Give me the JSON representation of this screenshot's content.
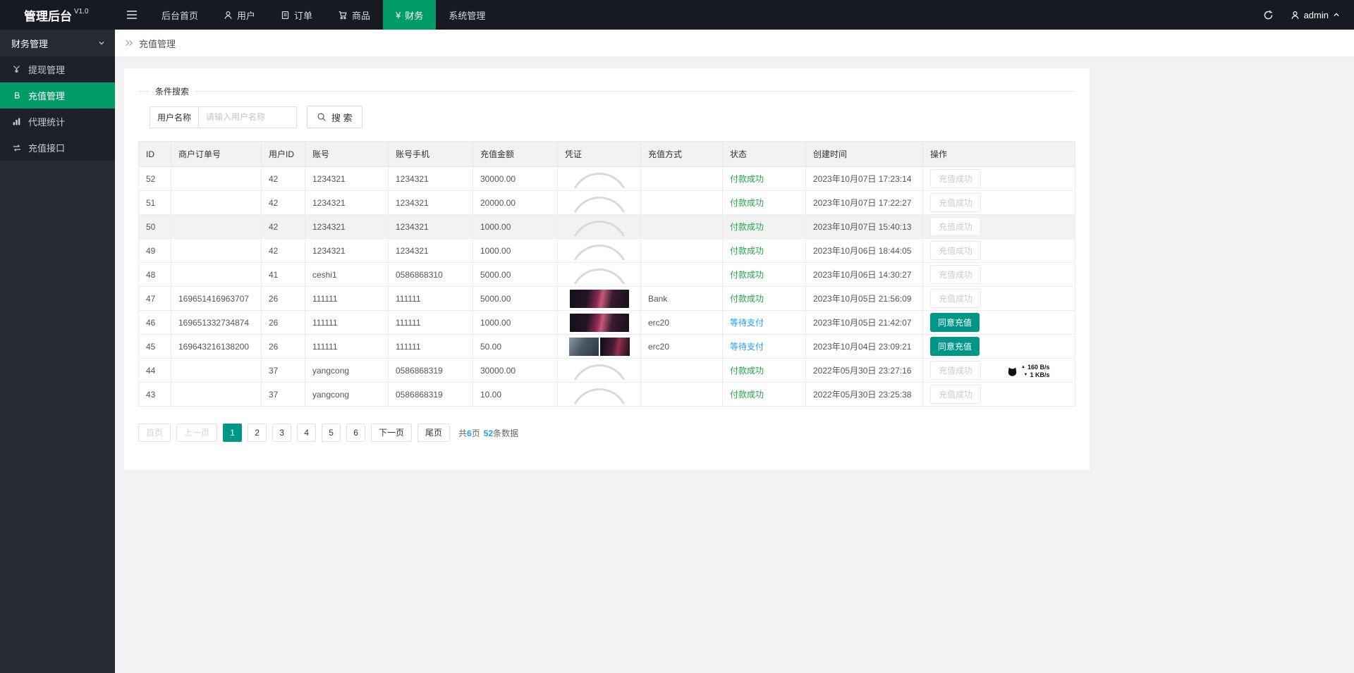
{
  "colors": {
    "nav_active_green": "#009b66",
    "button_teal": "#009688",
    "status_success_green": "#21a745",
    "status_pending_blue": "#1e9fff",
    "topbar_bg": "#171a23",
    "sidebar_bg": "#272a35"
  },
  "icons": {
    "yen": "¥"
  },
  "topbar": {
    "logo": "管理后台",
    "version": "V1.0",
    "menu": [
      {
        "label": "后台首页"
      },
      {
        "label": "用户"
      },
      {
        "label": "订单"
      },
      {
        "label": "商品"
      },
      {
        "label": "财务",
        "active": true
      },
      {
        "label": "系统管理"
      }
    ],
    "admin": "admin"
  },
  "sidebar": {
    "section_title": "财务管理",
    "items": [
      {
        "label": "提现管理"
      },
      {
        "label": "充值管理",
        "active": true
      },
      {
        "label": "代理统计"
      },
      {
        "label": "充值接口"
      }
    ]
  },
  "breadcrumb": {
    "title": "充值管理"
  },
  "search": {
    "legend": "条件搜索",
    "field_label": "用户名称",
    "placeholder": "请输入用户名称",
    "button_label": "搜 索"
  },
  "table": {
    "columns": [
      "ID",
      "商户订单号",
      "用户ID",
      "账号",
      "账号手机",
      "充值金额",
      "凭证",
      "充值方式",
      "状态",
      "创建时间",
      "操作"
    ],
    "rows": [
      {
        "id": "52",
        "order_no": "",
        "user_id": "42",
        "account": "1234321",
        "phone": "1234321",
        "amount": "30000.00",
        "voucher": "arc",
        "method": "",
        "status": "付款成功",
        "status_type": "success",
        "created": "2023年10月07日 17:23:14",
        "action": "充值成功",
        "action_type": "disabled"
      },
      {
        "id": "51",
        "order_no": "",
        "user_id": "42",
        "account": "1234321",
        "phone": "1234321",
        "amount": "20000.00",
        "voucher": "arc",
        "method": "",
        "status": "付款成功",
        "status_type": "success",
        "created": "2023年10月07日 17:22:27",
        "action": "充值成功",
        "action_type": "disabled"
      },
      {
        "id": "50",
        "order_no": "",
        "user_id": "42",
        "account": "1234321",
        "phone": "1234321",
        "amount": "1000.00",
        "voucher": "arc",
        "method": "",
        "status": "付款成功",
        "status_type": "success",
        "created": "2023年10月07日 15:40:13",
        "action": "充值成功",
        "action_type": "disabled",
        "highlighted": true
      },
      {
        "id": "49",
        "order_no": "",
        "user_id": "42",
        "account": "1234321",
        "phone": "1234321",
        "amount": "1000.00",
        "voucher": "arc",
        "method": "",
        "status": "付款成功",
        "status_type": "success",
        "created": "2023年10月06日 18:44:05",
        "action": "充值成功",
        "action_type": "disabled"
      },
      {
        "id": "48",
        "order_no": "",
        "user_id": "41",
        "account": "ceshi1",
        "phone": "0586868310",
        "amount": "5000.00",
        "voucher": "arc",
        "method": "",
        "status": "付款成功",
        "status_type": "success",
        "created": "2023年10月06日 14:30:27",
        "action": "充值成功",
        "action_type": "disabled"
      },
      {
        "id": "47",
        "order_no": "169651416963707",
        "user_id": "26",
        "account": "111111",
        "phone": "111111",
        "amount": "5000.00",
        "voucher": "photo",
        "method": "Bank",
        "status": "付款成功",
        "status_type": "success",
        "created": "2023年10月05日 21:56:09",
        "action": "充值成功",
        "action_type": "disabled"
      },
      {
        "id": "46",
        "order_no": "169651332734874",
        "user_id": "26",
        "account": "111111",
        "phone": "111111",
        "amount": "1000.00",
        "voucher": "photo",
        "method": "erc20",
        "status": "等待支付",
        "status_type": "pending",
        "created": "2023年10月05日 21:42:07",
        "action": "同意充值",
        "action_type": "approve"
      },
      {
        "id": "45",
        "order_no": "169643216138200",
        "user_id": "26",
        "account": "111111",
        "phone": "111111",
        "amount": "50.00",
        "voucher": "photo_pair",
        "method": "erc20",
        "status": "等待支付",
        "status_type": "pending",
        "created": "2023年10月04日 23:09:21",
        "action": "同意充值",
        "action_type": "approve"
      },
      {
        "id": "44",
        "order_no": "",
        "user_id": "37",
        "account": "yangcong",
        "phone": "0586868319",
        "amount": "30000.00",
        "voucher": "arc",
        "method": "",
        "status": "付款成功",
        "status_type": "success",
        "created": "2022年05月30日 23:27:16",
        "action": "充值成功",
        "action_type": "disabled"
      },
      {
        "id": "43",
        "order_no": "",
        "user_id": "37",
        "account": "yangcong",
        "phone": "0586868319",
        "amount": "10.00",
        "voucher": "arc",
        "method": "",
        "status": "付款成功",
        "status_type": "success",
        "created": "2022年05月30日 23:25:38",
        "action": "充值成功",
        "action_type": "disabled"
      }
    ]
  },
  "pagination": {
    "first_label": "首页",
    "prev_label": "上一页",
    "pages": [
      "1",
      "2",
      "3",
      "4",
      "5",
      "6"
    ],
    "active_page": "1",
    "next_label": "下一页",
    "last_label": "尾页",
    "total_pages": "6",
    "total_items": "52",
    "summary_prefix": "共",
    "summary_mid": "页",
    "summary_suffix": "条数据"
  },
  "traffic": {
    "up_value": "160 B/s",
    "down_value": "1 KB/s"
  }
}
